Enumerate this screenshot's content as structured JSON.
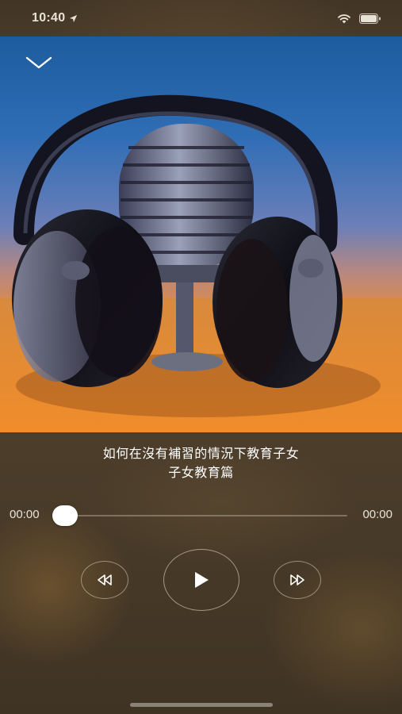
{
  "status_bar": {
    "time": "10:40",
    "icons": [
      "location-arrow-icon",
      "wifi-icon",
      "battery-icon"
    ]
  },
  "header": {
    "collapse_icon": "chevron-down-icon"
  },
  "artwork": {
    "description_icon": "headphones-microphone-artwork"
  },
  "track": {
    "title": "如何在沒有補習的情況下教育子女",
    "subtitle": "子女教育篇"
  },
  "progress": {
    "current_time": "00:00",
    "total_time": "00:00",
    "fraction": 0
  },
  "controls": {
    "rewind_icon": "rewind-icon",
    "play_icon": "play-icon",
    "forward_icon": "fast-forward-icon"
  },
  "colors": {
    "accent": "#ffffff",
    "background": "#4d3e2b"
  }
}
